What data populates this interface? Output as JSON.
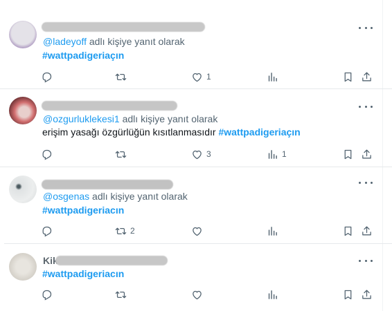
{
  "tweets": [
    {
      "header_visible": "@",
      "reply_prefix": "@ladeyoff",
      "reply_suffix": " adlı kişiye yanıt olarak",
      "body_text": "",
      "hashtag": "#wattpadigeriaçın",
      "likes": "1",
      "views": "",
      "retweets": ""
    },
    {
      "header_visible": "",
      "reply_prefix": "@ozgurluklekesi1",
      "reply_suffix": " adlı kişiye yanıt olarak",
      "body_text": "erişim yasağı özgürlüğün kısıtlanmasıdır ",
      "hashtag": "#wattpadigeriaçın",
      "likes": "3",
      "views": "1",
      "retweets": ""
    },
    {
      "header_visible": "",
      "reply_prefix": "@osgenas",
      "reply_suffix": " adlı kişiye yanıt olarak",
      "body_text": "",
      "hashtag": "#wattpadigeriacın",
      "likes": "",
      "views": "",
      "retweets": "2"
    },
    {
      "header_visible": "Kik",
      "reply_prefix": "",
      "reply_suffix": "",
      "body_text": "",
      "hashtag": "#wattpadigeriacın",
      "likes": "",
      "views": "",
      "retweets": ""
    }
  ],
  "icons": {
    "reply": "reply-icon",
    "retweet": "retweet-icon",
    "like": "like-icon",
    "views": "views-icon",
    "bookmark": "bookmark-icon",
    "share": "share-icon",
    "more": "more-icon"
  },
  "colors": {
    "link": "#1d9bf0",
    "muted": "#536471",
    "text": "#0f1419"
  }
}
